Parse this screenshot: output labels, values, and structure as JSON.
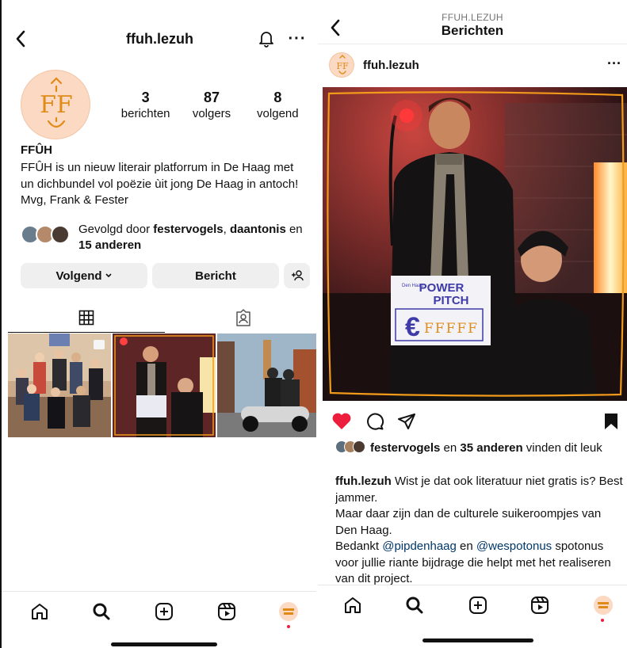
{
  "profile": {
    "username": "ffuh.lezuh",
    "stats": [
      {
        "num": "3",
        "label": "berichten"
      },
      {
        "num": "87",
        "label": "volgers"
      },
      {
        "num": "8",
        "label": "volgend"
      }
    ],
    "bio_name": "FFÛH",
    "bio_text": "FFÛH is un nieuw literair platforrum in De Haag met un dichbundel vol poëzie ùit jong De Haag in antoch! Mvg, Frank & Fester",
    "followed_prefix": "Gevolgd door ",
    "followed_user1": "festervogels",
    "followed_sep": ", ",
    "followed_user2": "daantonis",
    "followed_and": " en ",
    "followed_others": "15 anderen",
    "follow_button": "Volgend",
    "message_button": "Bericht",
    "logo_letters": "FF"
  },
  "post": {
    "subtitle": "FFUH.LEZUH",
    "title": "Berichten",
    "username": "ffuh.lezuh",
    "likes_user": "festervogels",
    "likes_mid": " en ",
    "likes_count": "35 anderen",
    "likes_suffix": " vinden dit leuk",
    "caption_user": "ffuh.lezuh",
    "caption_line1": " Wist je dat ook literatuur niet gratis is? Best jammer.",
    "caption_line2": "Maar daar zijn dan de culturele suikeroompjes van Den Haag.",
    "caption_pre": "Bedankt ",
    "mention1": "@pipdenhaag",
    "caption_mid": "  en ",
    "mention2": "@wespotonus",
    "caption_post": " spotonus voor jullie riante bijdrage die helpt met het realiseren van dit project.",
    "sign_line1": "POWER",
    "sign_line2": "PITCH",
    "sign_small": "Den Haag",
    "sign_euro": "€",
    "sign_ff": "FFFFF"
  },
  "tabbar_icons": [
    "home-icon",
    "search-icon",
    "create-icon",
    "reels-icon",
    "profile-avatar"
  ],
  "colors": {
    "accent_like": "#ed1d3d",
    "mention": "#00376b",
    "orange_frame": "#f29a1a",
    "avatar_bg": "#fbd9c2",
    "sign_blue": "#3e3aa8"
  }
}
